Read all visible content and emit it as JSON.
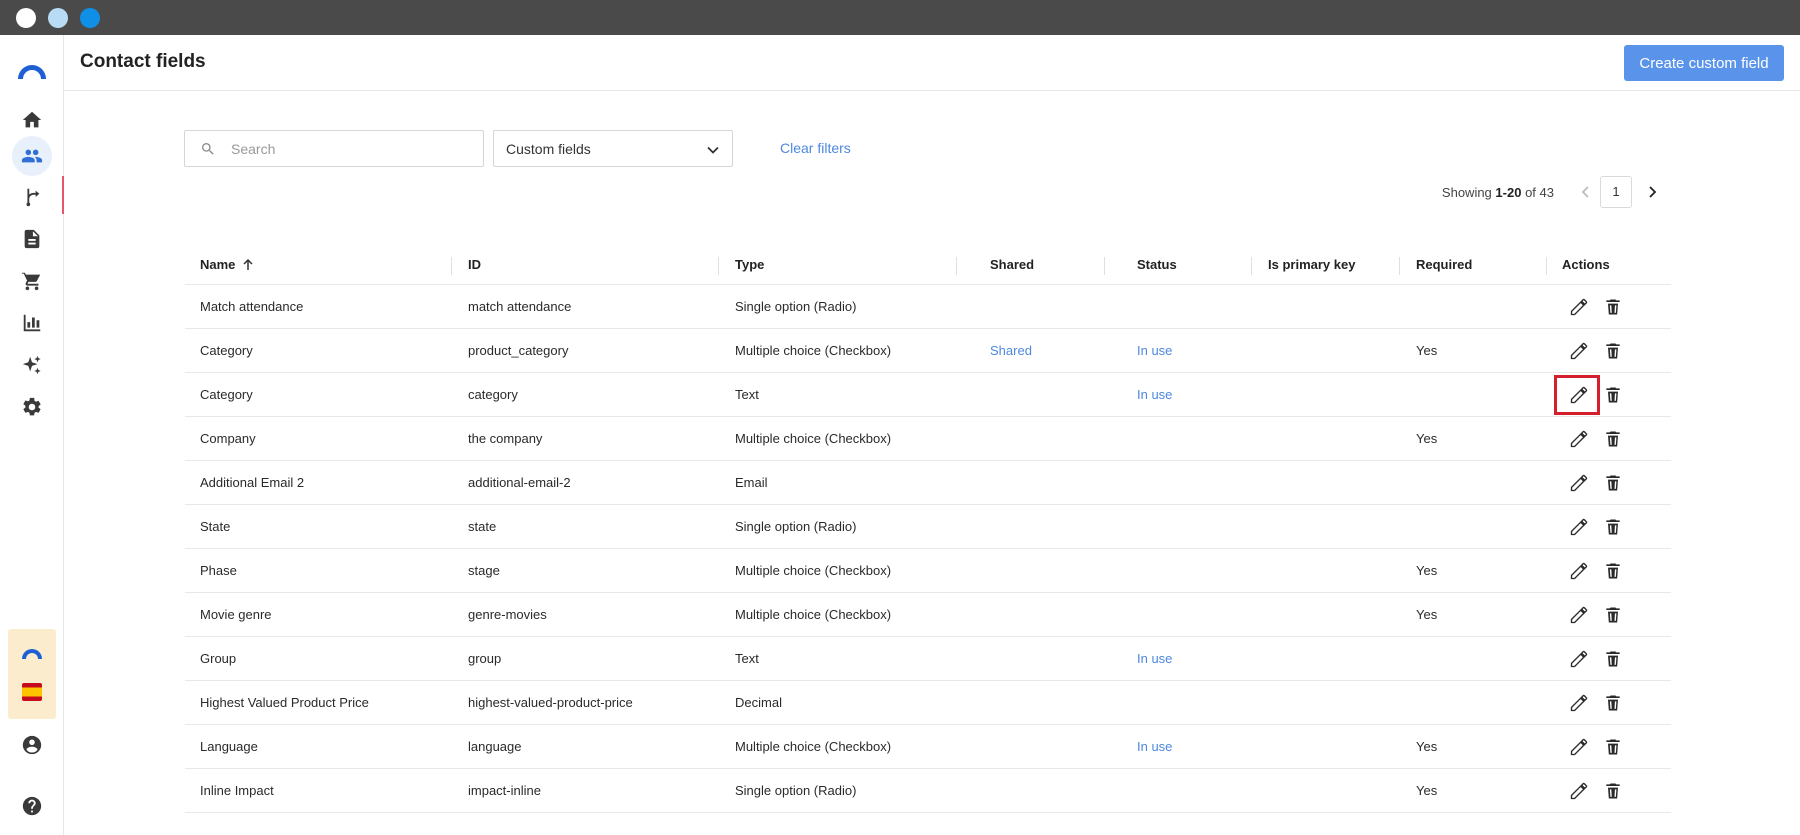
{
  "header": {
    "title": "Contact fields",
    "create_button": "Create custom field"
  },
  "sidebar": {
    "items": [
      {
        "icon": "home-icon"
      },
      {
        "icon": "contacts-icon",
        "active": true
      },
      {
        "icon": "automation-icon"
      },
      {
        "icon": "document-icon"
      },
      {
        "icon": "cart-icon"
      },
      {
        "icon": "chart-icon"
      },
      {
        "icon": "sparkle-icon"
      },
      {
        "icon": "gear-icon"
      },
      {
        "icon": "user-icon"
      },
      {
        "icon": "help-icon"
      }
    ],
    "accent_color": "#2f6fd6"
  },
  "filters": {
    "search_placeholder": "Search",
    "select_value": "Custom fields",
    "clear_label": "Clear filters"
  },
  "pagination": {
    "showing_label": "Showing",
    "range": "1-20",
    "of_label": "of 43",
    "page": "1"
  },
  "table": {
    "columns": [
      "Name",
      "ID",
      "Type",
      "Shared",
      "Status",
      "Is primary key",
      "Required",
      "Actions"
    ],
    "rows": [
      {
        "name": "Match attendance",
        "id": "match attendance",
        "type": "Single option (Radio)",
        "shared": "",
        "status": "",
        "pk": "",
        "required": ""
      },
      {
        "name": "Category",
        "id": "product_category",
        "type": "Multiple choice (Checkbox)",
        "shared": "Shared",
        "status": "In use",
        "pk": "",
        "required": "Yes"
      },
      {
        "name": "Category",
        "id": "category",
        "type": "Text",
        "shared": "",
        "status": "In use",
        "pk": "",
        "required": ""
      },
      {
        "name": "Company",
        "id": "the company",
        "type": "Multiple choice (Checkbox)",
        "shared": "",
        "status": "",
        "pk": "",
        "required": "Yes"
      },
      {
        "name": "Additional Email 2",
        "id": "additional-email-2",
        "type": "Email",
        "shared": "",
        "status": "",
        "pk": "",
        "required": ""
      },
      {
        "name": "State",
        "id": "state",
        "type": "Single option (Radio)",
        "shared": "",
        "status": "",
        "pk": "",
        "required": ""
      },
      {
        "name": "Phase",
        "id": "stage",
        "type": "Multiple choice (Checkbox)",
        "shared": "",
        "status": "",
        "pk": "",
        "required": "Yes"
      },
      {
        "name": "Movie genre",
        "id": "genre-movies",
        "type": "Multiple choice (Checkbox)",
        "shared": "",
        "status": "",
        "pk": "",
        "required": "Yes"
      },
      {
        "name": "Group",
        "id": "group",
        "type": "Text",
        "shared": "",
        "status": "In use",
        "pk": "",
        "required": ""
      },
      {
        "name": "Highest Valued Product Price",
        "id": "highest-valued-product-price",
        "type": "Decimal",
        "shared": "",
        "status": "",
        "pk": "",
        "required": ""
      },
      {
        "name": "Language",
        "id": "language",
        "type": "Multiple choice (Checkbox)",
        "shared": "",
        "status": "In use",
        "pk": "",
        "required": "Yes"
      },
      {
        "name": "Inline Impact",
        "id": "impact-inline",
        "type": "Single option (Radio)",
        "shared": "",
        "status": "",
        "pk": "",
        "required": "Yes"
      }
    ]
  },
  "colors": {
    "primary_button": "#5a93ea",
    "link": "#4f88df",
    "highlight": "#d4202c"
  }
}
